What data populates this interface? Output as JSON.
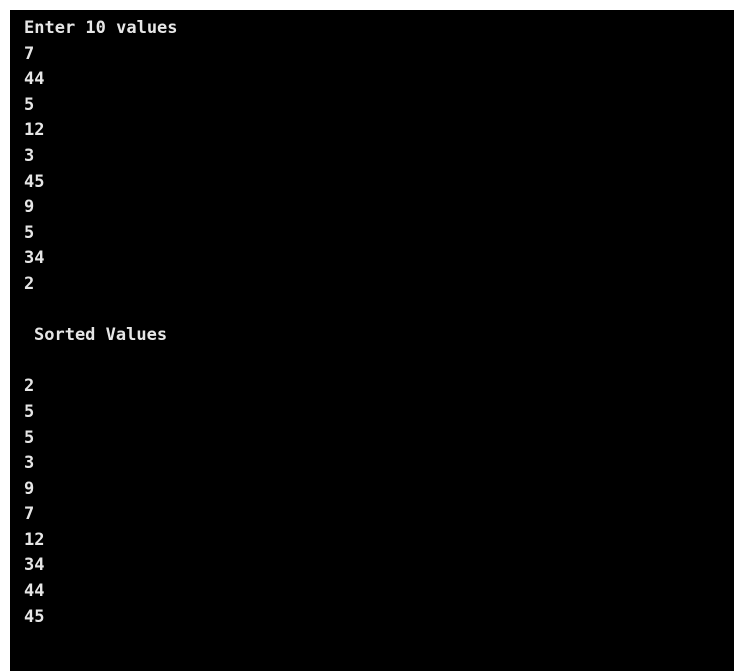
{
  "console": {
    "prompt": "Enter 10 values",
    "inputs": [
      "7",
      "44",
      "5",
      "12",
      "3",
      "45",
      "9",
      "5",
      "34",
      "2"
    ],
    "sorted_heading": "Sorted Values",
    "sorted": [
      "2",
      "5",
      "5",
      "3",
      "9",
      "7",
      "12",
      "34",
      "44",
      "45"
    ]
  },
  "colors": {
    "background": "#000000",
    "text": "#e6e6e6"
  }
}
